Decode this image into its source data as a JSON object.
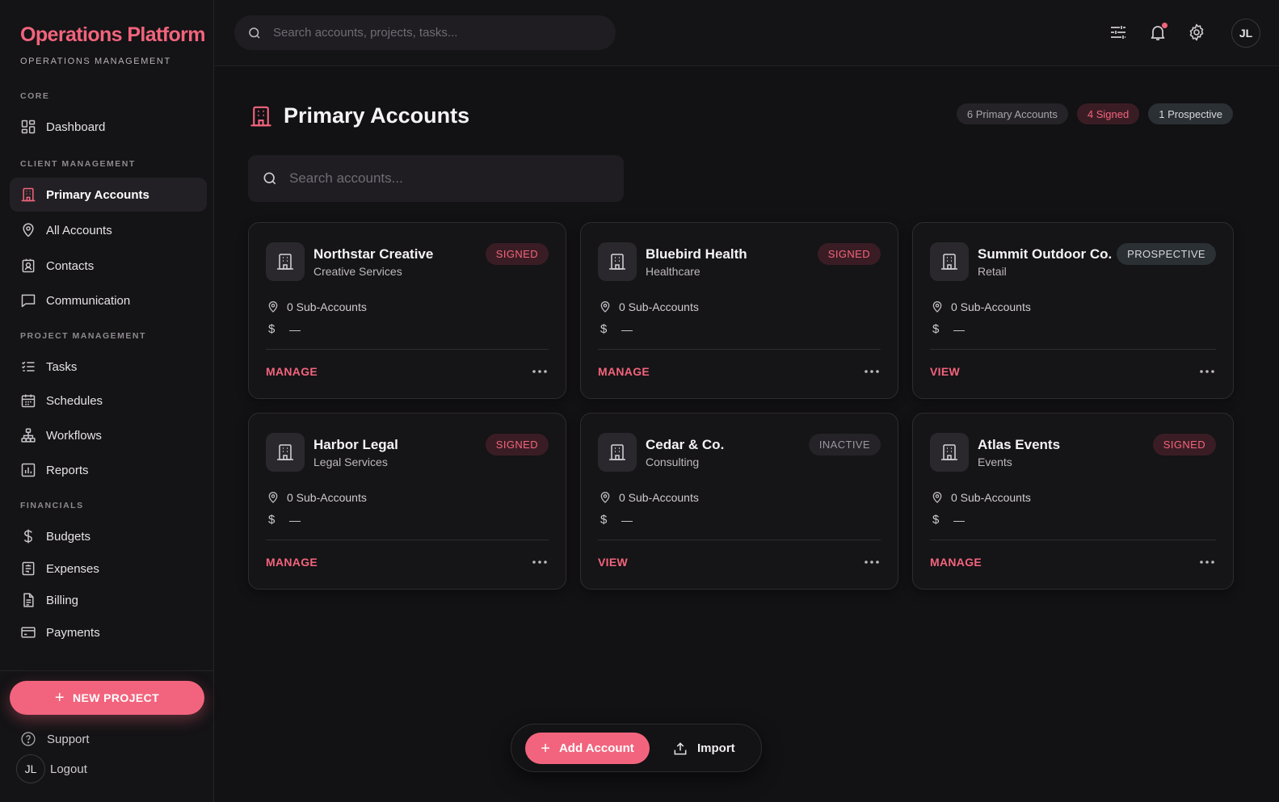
{
  "brand": {
    "title": "Operations Platform",
    "subtitle": "OPERATIONS MANAGEMENT"
  },
  "sidebar": {
    "sections": [
      {
        "label": "CORE"
      },
      {
        "label": "CLIENT MANAGEMENT"
      },
      {
        "label": "PROJECT MANAGEMENT"
      },
      {
        "label": "FINANCIALS"
      }
    ],
    "items": [
      {
        "label": "Dashboard",
        "icon": "dashboard-icon"
      },
      {
        "label": "Primary Accounts",
        "icon": "building-icon",
        "active": true
      },
      {
        "label": "All Accounts",
        "icon": "map-pin-icon"
      },
      {
        "label": "Contacts",
        "icon": "contact-card-icon"
      },
      {
        "label": "Communication",
        "icon": "chat-icon"
      },
      {
        "label": "Tasks",
        "icon": "task-list-icon"
      },
      {
        "label": "Schedules",
        "icon": "calendar-icon"
      },
      {
        "label": "Workflows",
        "icon": "workflow-icon"
      },
      {
        "label": "Reports",
        "icon": "bar-chart-icon"
      },
      {
        "label": "Budgets",
        "icon": "dollar-icon"
      },
      {
        "label": "Expenses",
        "icon": "receipt-icon"
      },
      {
        "label": "Billing",
        "icon": "document-icon"
      },
      {
        "label": "Payments",
        "icon": "credit-card-icon"
      }
    ],
    "new_project_label": "NEW PROJECT",
    "support_label": "Support",
    "logout_label": "Logout",
    "user_initials": "JL"
  },
  "topbar": {
    "search_placeholder": "Search accounts, projects, tasks...",
    "user_initials": "JL"
  },
  "page": {
    "title": "Primary Accounts",
    "badges": {
      "total": "6 Primary Accounts",
      "signed": "4 Signed",
      "prospective": "1 Prospective"
    },
    "search_placeholder": "Search accounts..."
  },
  "accounts": [
    {
      "name": "Northstar Creative",
      "industry": "Creative Services",
      "status": "SIGNED",
      "sub_accounts": "0 Sub-Accounts",
      "currency": "$",
      "amount": "—",
      "action": "MANAGE"
    },
    {
      "name": "Bluebird Health",
      "industry": "Healthcare",
      "status": "SIGNED",
      "sub_accounts": "0 Sub-Accounts",
      "currency": "$",
      "amount": "—",
      "action": "MANAGE"
    },
    {
      "name": "Summit Outdoor Co.",
      "industry": "Retail",
      "status": "PROSPECTIVE",
      "sub_accounts": "0 Sub-Accounts",
      "currency": "$",
      "amount": "—",
      "action": "VIEW"
    },
    {
      "name": "Harbor Legal",
      "industry": "Legal Services",
      "status": "SIGNED",
      "sub_accounts": "0 Sub-Accounts",
      "currency": "$",
      "amount": "—",
      "action": "MANAGE"
    },
    {
      "name": "Cedar & Co.",
      "industry": "Consulting",
      "status": "INACTIVE",
      "sub_accounts": "0 Sub-Accounts",
      "currency": "$",
      "amount": "—",
      "action": "VIEW"
    },
    {
      "name": "Atlas Events",
      "industry": "Events",
      "status": "SIGNED",
      "sub_accounts": "0 Sub-Accounts",
      "currency": "$",
      "amount": "—",
      "action": "MANAGE"
    }
  ],
  "floating_bar": {
    "add_label": "Add Account",
    "import_label": "Import"
  },
  "colors": {
    "accent": "#f2647d",
    "background": "#121113",
    "card": "#151416",
    "prospective": "#2b3035",
    "inactive": "#252327"
  }
}
